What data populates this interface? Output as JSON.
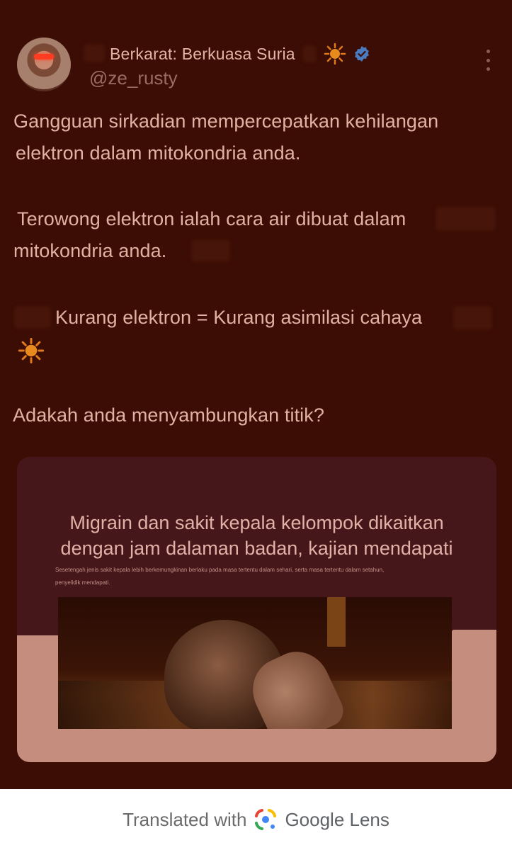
{
  "tweet": {
    "display_name": "Berkarat: Berkuasa Suria",
    "handle": "@ze_rusty",
    "paragraphs": [
      "Gangguan sirkadian mempercepatkan kehilangan",
      "elektron dalam mitokondria anda.",
      "Terowong elektron ialah cara air dibuat dalam",
      "mitokondria anda.",
      "Kurang elektron = Kurang asimilasi cahaya",
      "Adakah anda menyambungkan titik?"
    ],
    "icons": {
      "sun": "sun-icon",
      "verified": "verified-badge-icon",
      "more": "more-options-icon"
    }
  },
  "card": {
    "title_line1": "Migrain dan sakit kepala kelompok dikaitkan",
    "title_line2": "dengan jam dalaman badan, kajian mendapati",
    "subtitle_line1": "Sesetengah jenis sakit kepala lebih berkemungkinan berlaku pada masa tertentu dalam sehari, serta masa tertentu dalam setahun,",
    "subtitle_line2": "penyelidik mendapati."
  },
  "footer": {
    "translated_with": "Translated with",
    "brand": "Google Lens"
  },
  "colors": {
    "background": "#3b0d04",
    "text": "#e3b1a3",
    "handle": "#9a6b60",
    "card": "#46171a",
    "verified": "#4a7bbf"
  }
}
